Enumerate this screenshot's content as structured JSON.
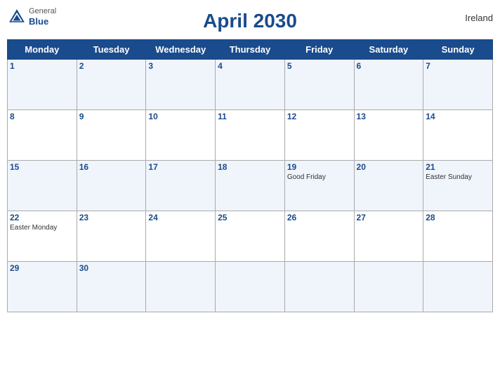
{
  "header": {
    "title": "April 2030",
    "country": "Ireland",
    "logo": {
      "general": "General",
      "blue": "Blue"
    }
  },
  "weekdays": [
    "Monday",
    "Tuesday",
    "Wednesday",
    "Thursday",
    "Friday",
    "Saturday",
    "Sunday"
  ],
  "weeks": [
    [
      {
        "day": 1,
        "event": ""
      },
      {
        "day": 2,
        "event": ""
      },
      {
        "day": 3,
        "event": ""
      },
      {
        "day": 4,
        "event": ""
      },
      {
        "day": 5,
        "event": ""
      },
      {
        "day": 6,
        "event": ""
      },
      {
        "day": 7,
        "event": ""
      }
    ],
    [
      {
        "day": 8,
        "event": ""
      },
      {
        "day": 9,
        "event": ""
      },
      {
        "day": 10,
        "event": ""
      },
      {
        "day": 11,
        "event": ""
      },
      {
        "day": 12,
        "event": ""
      },
      {
        "day": 13,
        "event": ""
      },
      {
        "day": 14,
        "event": ""
      }
    ],
    [
      {
        "day": 15,
        "event": ""
      },
      {
        "day": 16,
        "event": ""
      },
      {
        "day": 17,
        "event": ""
      },
      {
        "day": 18,
        "event": ""
      },
      {
        "day": 19,
        "event": "Good Friday"
      },
      {
        "day": 20,
        "event": ""
      },
      {
        "day": 21,
        "event": "Easter Sunday"
      }
    ],
    [
      {
        "day": 22,
        "event": "Easter Monday"
      },
      {
        "day": 23,
        "event": ""
      },
      {
        "day": 24,
        "event": ""
      },
      {
        "day": 25,
        "event": ""
      },
      {
        "day": 26,
        "event": ""
      },
      {
        "day": 27,
        "event": ""
      },
      {
        "day": 28,
        "event": ""
      }
    ],
    [
      {
        "day": 29,
        "event": ""
      },
      {
        "day": 30,
        "event": ""
      },
      {
        "day": null,
        "event": ""
      },
      {
        "day": null,
        "event": ""
      },
      {
        "day": null,
        "event": ""
      },
      {
        "day": null,
        "event": ""
      },
      {
        "day": null,
        "event": ""
      }
    ]
  ],
  "colors": {
    "header_bg": "#1a4b8c",
    "header_text": "#ffffff",
    "day_number": "#1a4b8c"
  }
}
